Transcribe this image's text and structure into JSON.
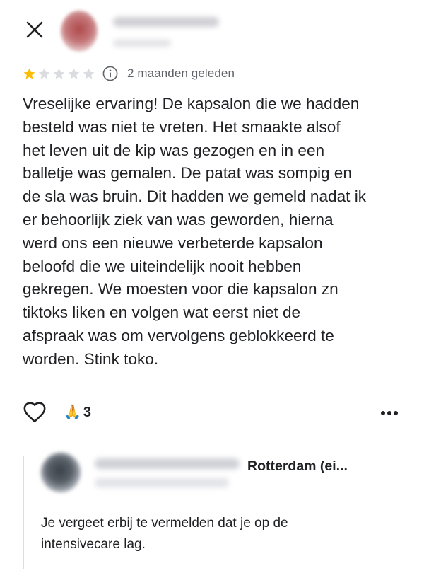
{
  "header": {
    "close_icon": "close-icon",
    "reviewer_avatar": "blurred-avatar",
    "reviewer_name": "",
    "reviewer_meta": ""
  },
  "review": {
    "rating": 1,
    "rating_max": 5,
    "star_color_filled": "#fbbc04",
    "star_color_empty": "#dadce0",
    "info_icon": "info-icon",
    "time": "2 maanden geleden",
    "text": "Vreselijke ervaring! De kapsalon die we hadden\nbesteld was niet te vreten. Het smaakte alsof\nhet leven uit de kip was gezogen en in een\nballetje was gemalen. De patat was sompig en\nde sla was bruin. Dit hadden we gemeld nadat ik\ner behoorlijk ziek van was geworden, hierna\nwerd ons een nieuwe verbeterde kapsalon\nbeloofd die we uiteindelijk nooit hebben\ngekregen. We moesten voor die kapsalon zn\ntiktoks liken en volgen wat eerst niet de\nafspraak was om vervolgens geblokkeerd te\nworden. Stink toko."
  },
  "actions": {
    "like_icon": "heart-icon",
    "reaction_emoji": "🙏",
    "reaction_count": "3",
    "more_icon": "more-horizontal-icon"
  },
  "reply": {
    "avatar": "blurred-avatar",
    "owner_name": "",
    "owner_meta": "",
    "location": "Rotterdam (ei...",
    "text": "Je vergeet erbij te vermelden dat je op de\nintensivecare lag."
  }
}
